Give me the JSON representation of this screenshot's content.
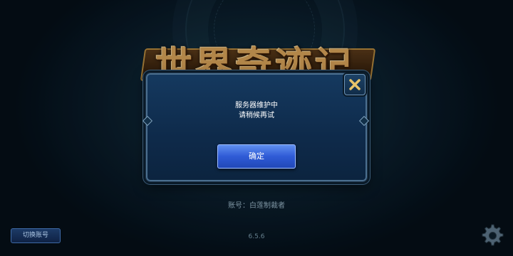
{
  "logo": {
    "title": "世界奇迹记"
  },
  "dialog": {
    "message_line1": "服务器维护中",
    "message_line2": "请稍候再试",
    "confirm_label": "确定",
    "close_icon": "close-icon"
  },
  "footer": {
    "account_text": "账号：白莲制裁者",
    "version": "6.5.6",
    "switch_account_label": "切换账号",
    "settings_icon": "gear-icon"
  },
  "colors": {
    "dialog_bg": "#0e2a4a",
    "button_blue": "#2f5bd6",
    "logo_gold": "#d9a45a",
    "close_x_gold": "#e8c46a"
  }
}
